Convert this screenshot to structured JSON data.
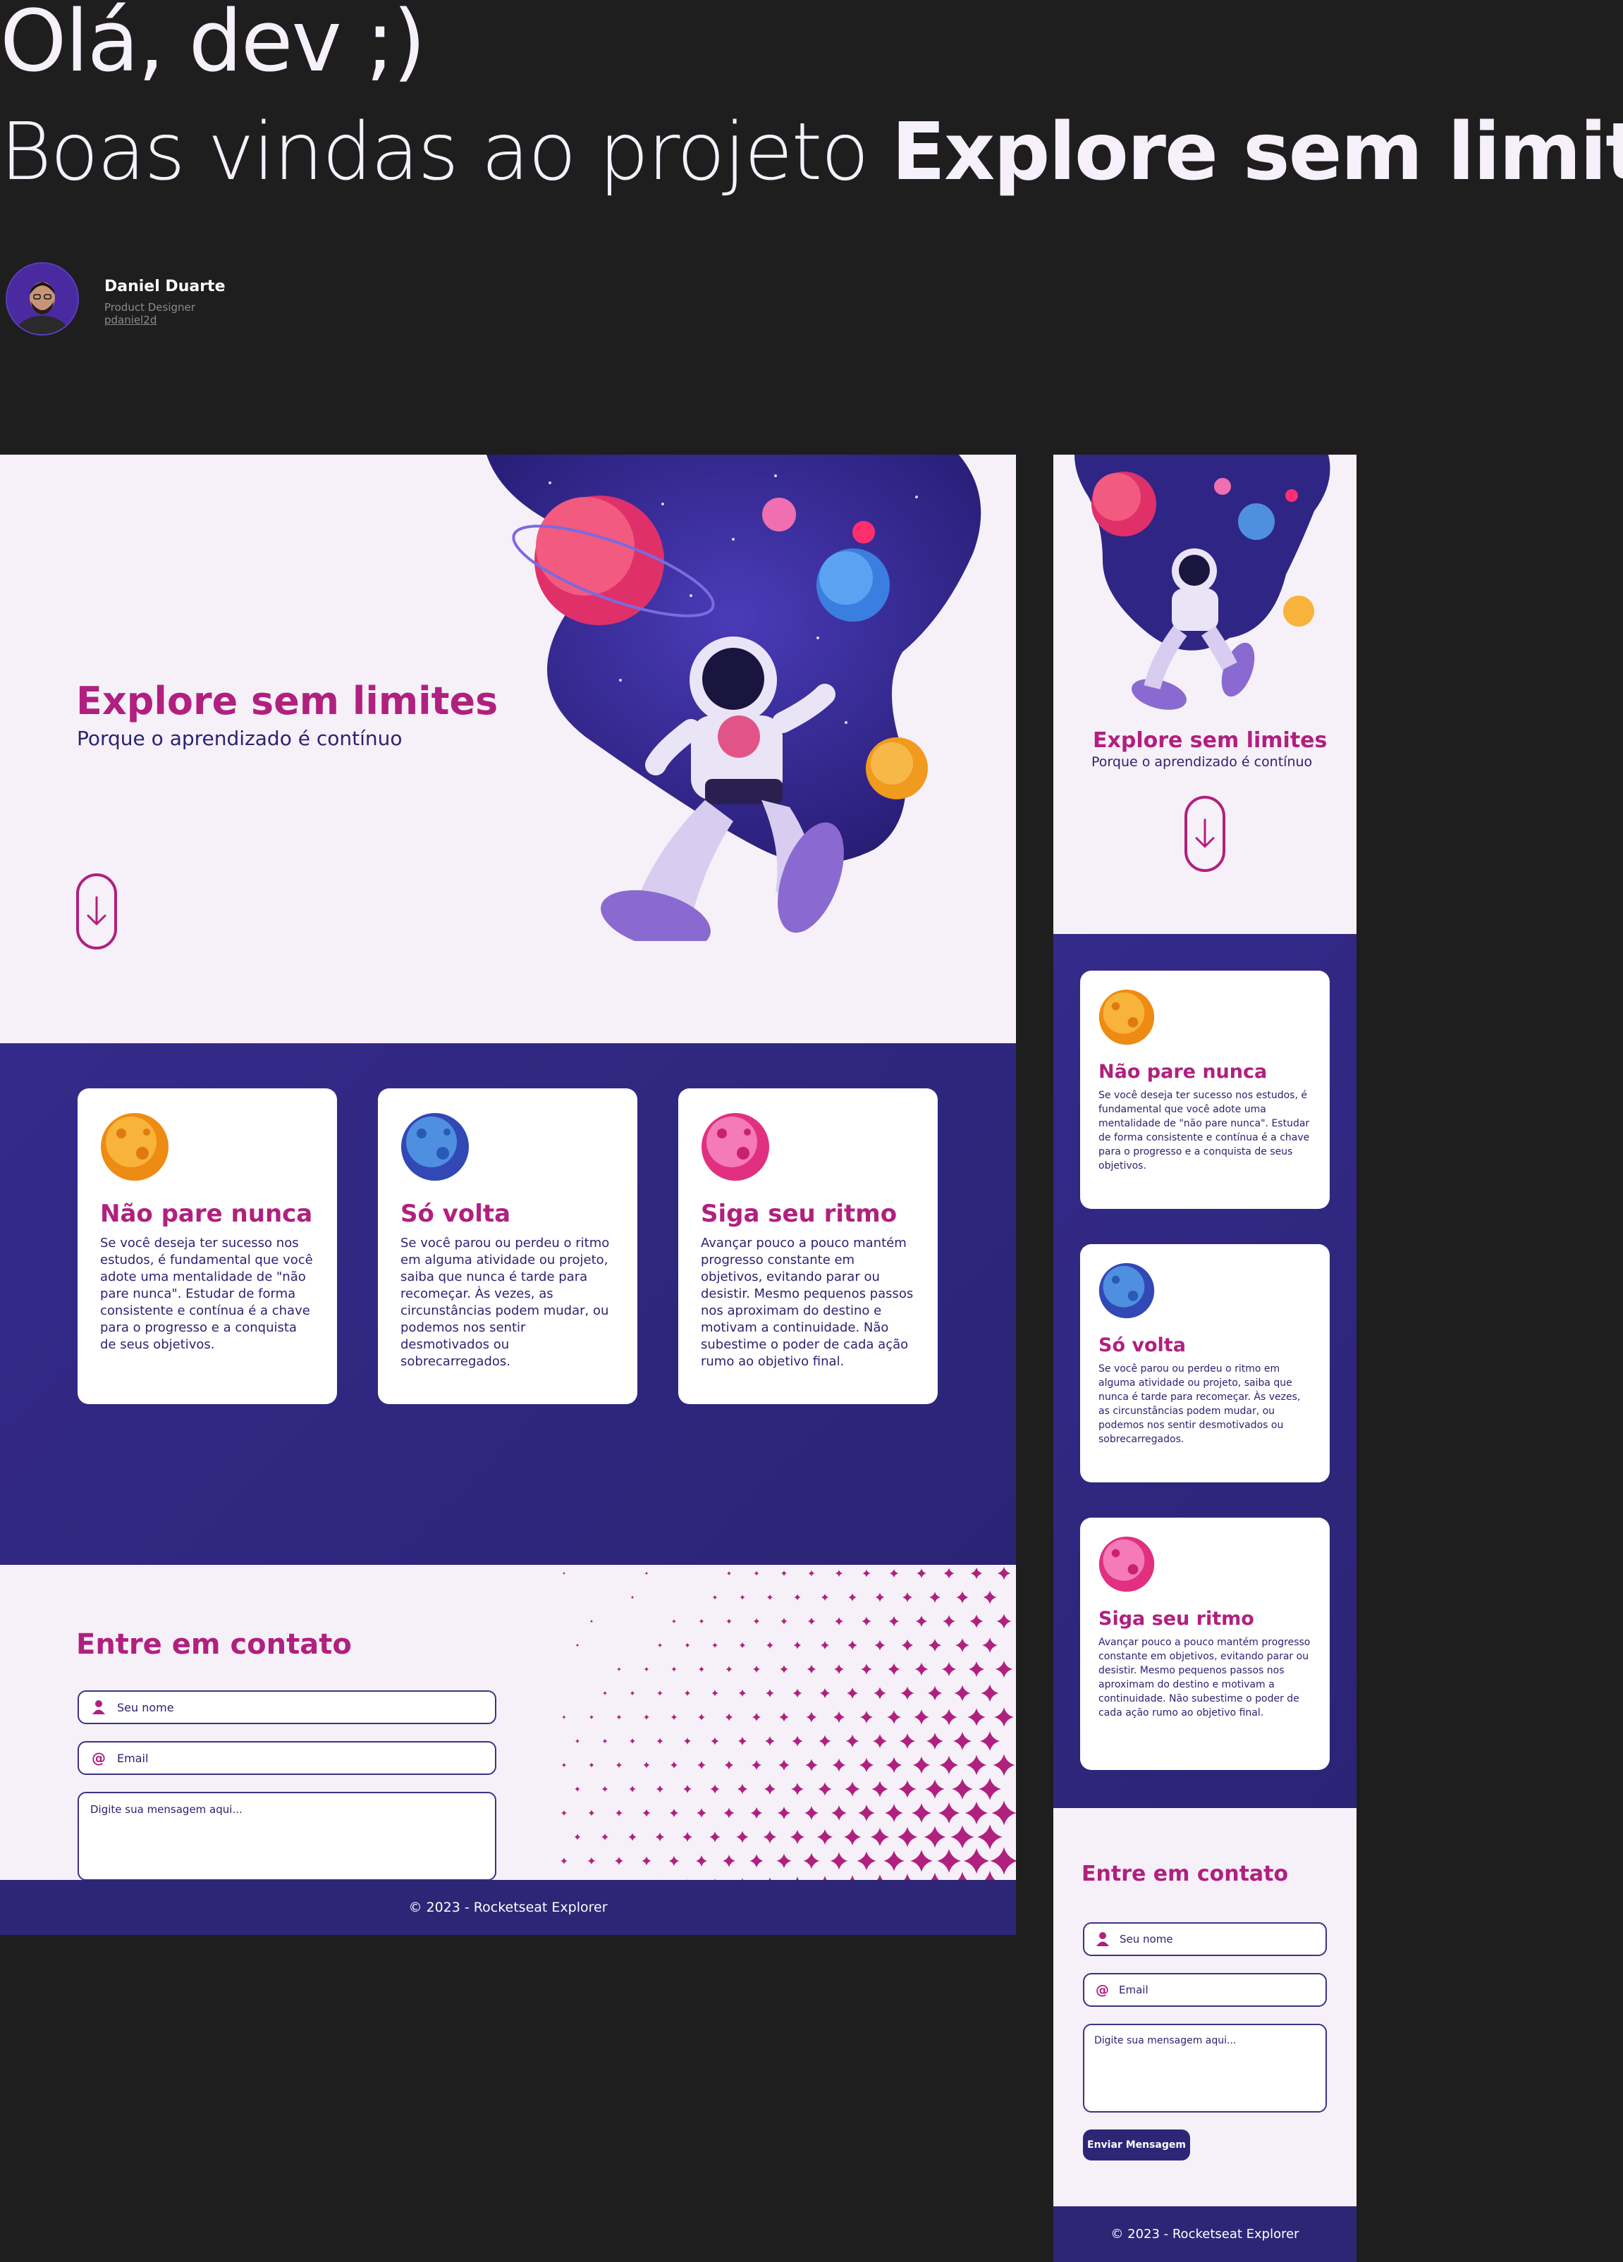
{
  "header": {
    "greeting": "Olá, dev ;)",
    "welcome_prefix": "Boas vindas ao projeto ",
    "welcome_project": "Explore sem limites"
  },
  "author": {
    "name": "Daniel Duarte",
    "role": "Product Designer",
    "handle": "pdaniel2d"
  },
  "site": {
    "hero_title": "Explore sem limites",
    "hero_subtitle": "Porque o aprendizado é contínuo",
    "cards": [
      {
        "title": "Não pare nunca",
        "text": "Se você deseja ter sucesso nos estudos, é fundamental que você adote uma mentalidade de \"não pare nunca\". Estudar de forma consistente e contínua é a chave para o progresso e a conquista de seus objetivos.",
        "planet_icon": "orange-planet-icon"
      },
      {
        "title": "Só volta",
        "text": "Se você parou ou perdeu o ritmo em alguma atividade ou projeto, saiba que nunca é tarde para recomeçar. Às vezes, as circunstâncias podem mudar, ou podemos nos sentir desmotivados ou sobrecarregados.",
        "planet_icon": "blue-planet-icon"
      },
      {
        "title": "Siga seu ritmo",
        "text": "Avançar pouco a pouco mantém progresso constante em objetivos, evitando parar ou desistir. Mesmo pequenos passos nos aproximam do destino e motivam a continuidade. Não subestime o poder de cada ação rumo ao objetivo final.",
        "planet_icon": "pink-planet-icon"
      }
    ],
    "contact": {
      "title": "Entre em contato",
      "name_placeholder": "Seu nome",
      "email_placeholder": "Email",
      "message_placeholder": "Digite sua mensagem aqui...",
      "submit_label": "Enviar Mensagem"
    },
    "footer": "© 2023 - Rocketseat Explorer"
  },
  "colors": {
    "brand_magenta": "#b0207f",
    "brand_indigo": "#2d2676",
    "page_bg": "#f6f0f9",
    "canvas_bg": "#1e1e1e"
  }
}
